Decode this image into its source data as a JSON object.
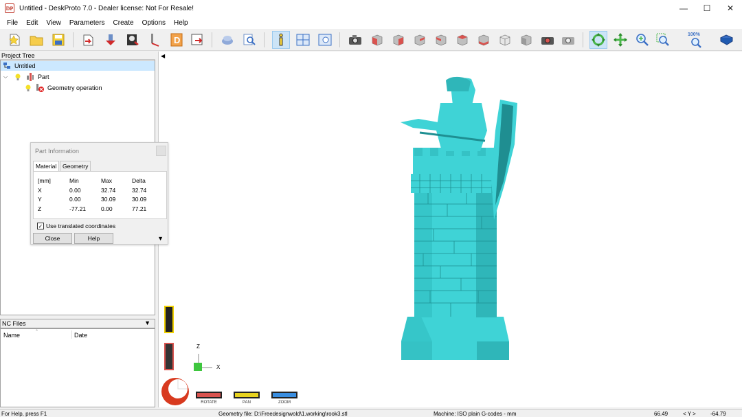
{
  "window": {
    "icon_text": "DP",
    "title": "Untitled - DeskProto 7.0 - Dealer license: Not For Resale!",
    "minimize": "—",
    "maximize": "☐",
    "close": "✕"
  },
  "menu": [
    "File",
    "Edit",
    "View",
    "Parameters",
    "Create",
    "Options",
    "Help"
  ],
  "toolbar": {
    "zoom_label": "100%",
    "colors": {
      "active_bg": "#cce4f7",
      "cube_red": "#d9534f",
      "cube_grey": "#bfbfbf"
    }
  },
  "project_tree": {
    "title": "Project Tree",
    "root": "Untitled",
    "part": "Part",
    "operation": "Geometry operation"
  },
  "nc_files": {
    "title": "NC Files",
    "col_name": "Name",
    "col_date": "Date"
  },
  "part_info": {
    "title": "Part Information",
    "tabs": [
      "Material",
      "Geometry"
    ],
    "headers": [
      "[mm]",
      "Min",
      "Max",
      "Delta"
    ],
    "rows": [
      [
        "X",
        "0.00",
        "32.74",
        "32.74"
      ],
      [
        "Y",
        "0.00",
        "30.09",
        "30.09"
      ],
      [
        "Z",
        "-77.21",
        "0.00",
        "77.21"
      ]
    ],
    "checkbox_label": "Use translated coordinates",
    "checkbox_checked": true,
    "close_button": "Close",
    "help_button": "Help"
  },
  "viewport": {
    "axis_z": "Z",
    "axis_x": "X",
    "model_color": "#3fd3d6",
    "rotate_label": "ROTATE",
    "pan_label": "PAN",
    "zoom_label": "ZOOM"
  },
  "status": {
    "help": "For Help, press F1",
    "geometry_file": "Geometry file: D:\\Freedesignwold\\1.working\\rook3.stl",
    "machine": "Machine: ISO plain G-codes - mm",
    "x_value": "66.49",
    "y_label": "< Y >",
    "y_value": "-64.79"
  }
}
